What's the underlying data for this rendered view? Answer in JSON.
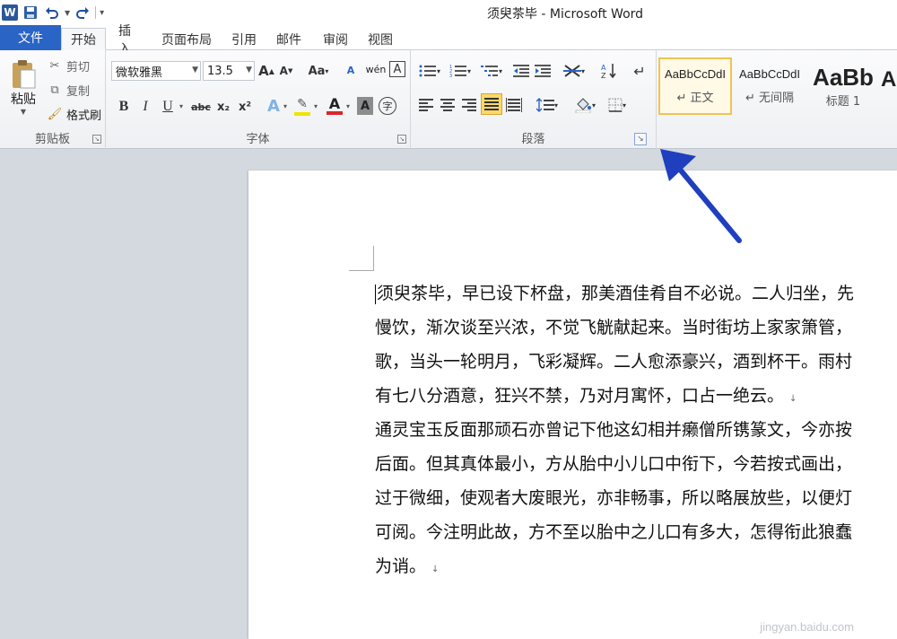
{
  "window": {
    "title": "须臾茶毕 - Microsoft Word",
    "app_icon": "W"
  },
  "quick_access": {
    "icons": [
      "word-app-icon",
      "save-icon",
      "undo-icon",
      "redo-icon",
      "customize-icon"
    ]
  },
  "tabs": {
    "file": "文件",
    "items": [
      "开始",
      "插入",
      "页面布局",
      "引用",
      "邮件",
      "审阅",
      "视图"
    ],
    "active": "开始"
  },
  "clipboard": {
    "paste": "粘贴",
    "cut": "剪切",
    "copy": "复制",
    "format_painter": "格式刷",
    "label": "剪贴板"
  },
  "font": {
    "name": "微软雅黑",
    "size": "13.5",
    "grow": "A",
    "shrink": "A",
    "change_case": "Aa",
    "clear_format": "A",
    "phonetic": "wén",
    "char_border": "A",
    "bold": "B",
    "italic": "I",
    "underline": "U",
    "strikethrough": "abc",
    "subscript": "x₂",
    "superscript": "x²",
    "text_effect": "A",
    "font_color": "A",
    "char_shading": "A",
    "enclosed_char": "字",
    "label": "字体",
    "colors": {
      "highlight": "#f2e200",
      "font_color": "#d9262b"
    }
  },
  "paragraph": {
    "label": "段落"
  },
  "styles": {
    "items": [
      {
        "sample": "AaBbCcDdI",
        "name": "↵ 正文"
      },
      {
        "sample": "AaBbCcDdI",
        "name": "↵ 无间隔"
      },
      {
        "sample": "AaBb",
        "name": "标题 1"
      },
      {
        "sample": "A",
        "name": ""
      }
    ]
  },
  "document": {
    "paragraph1": [
      "须臾茶毕，早已设下杯盘，那美酒佳肴自不必说。二人归坐，先",
      "慢饮，渐次谈至兴浓，不觉飞觥献起来。当时街坊上家家箫管，",
      "歌，当头一轮明月，飞彩凝辉。二人愈添豪兴，酒到杯干。雨村",
      "有七八分酒意，狂兴不禁，乃对月寓怀，口占一绝云。"
    ],
    "paragraph2": [
      "通灵宝玉反面那顽石亦曾记下他这幻相并癞僧所镌篆文，今亦按",
      "后面。但其真体最小，方从胎中小儿口中衔下，今若按式画出，",
      "过于微细，使观者大废眼光，亦非畅事，所以略展放些，以便灯",
      "可阅。今注明此故，方不至以胎中之儿口有多大，怎得衔此狼蠢",
      "为诮。"
    ],
    "para_mark": "↓"
  },
  "watermark": "jingyan.baidu.com",
  "annotation": {
    "color": "#1f3fbf"
  }
}
